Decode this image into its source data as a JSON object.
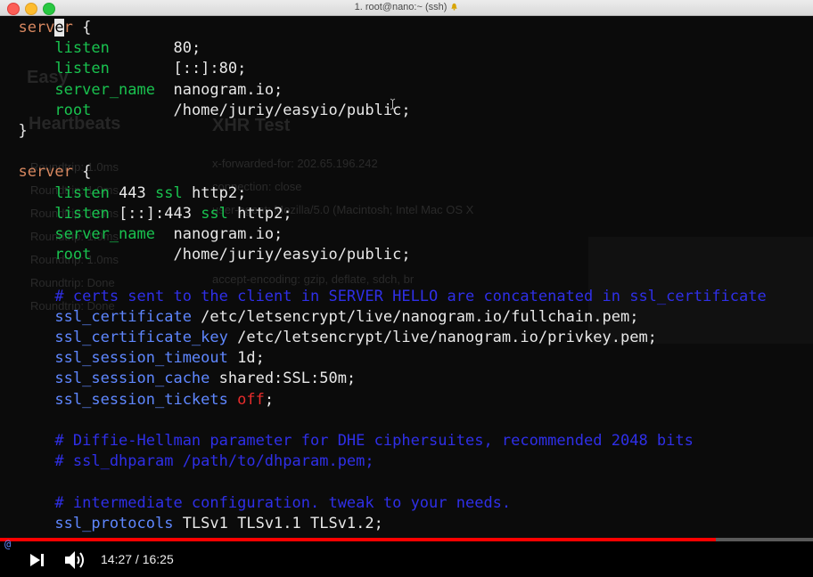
{
  "window": {
    "title": "1. root@nano:~ (ssh)"
  },
  "background_page": {
    "heading": "Easy",
    "section": "Heartbeats",
    "xhr_title": "XHR Test",
    "rows": [
      "Roundtrip: 1.0ms",
      "Roundtrip: 1.0ms",
      "Roundtrip: 1.0ms",
      "Roundtrip: 1.0ms",
      "Roundtrip: 1.0ms",
      "Roundtrip: Done",
      "Roundtrip: Done"
    ],
    "headers": [
      "x-forwarded-for: 202.65.196.242",
      "connection: close",
      "user-agent: Mozilla/5.0 (Macintosh; Intel Mac OS X",
      "accept-encoding: gzip, deflate, sdch, br"
    ]
  },
  "terminal": {
    "lines": [
      [
        {
          "t": "  serv",
          "c": "k"
        },
        {
          "t": "e",
          "c": "cursor"
        },
        {
          "t": "r",
          "c": "k"
        },
        {
          "t": " {",
          "c": "v"
        }
      ],
      [
        {
          "t": "      listen",
          "c": "d"
        },
        {
          "t": "       80;",
          "c": "v"
        }
      ],
      [
        {
          "t": "      listen",
          "c": "d"
        },
        {
          "t": "       [::]:80;",
          "c": "v"
        }
      ],
      [
        {
          "t": "      server_name",
          "c": "d"
        },
        {
          "t": "  nanogram.io;",
          "c": "v"
        }
      ],
      [
        {
          "t": "      root",
          "c": "d"
        },
        {
          "t": "         /home/juriy/easyio/public;",
          "c": "v"
        }
      ],
      [
        {
          "t": "  }",
          "c": "v"
        }
      ],
      [],
      [
        {
          "t": "  server",
          "c": "k"
        },
        {
          "t": " {",
          "c": "v"
        }
      ],
      [
        {
          "t": "      listen",
          "c": "d"
        },
        {
          "t": " 443 ",
          "c": "v"
        },
        {
          "t": "ssl",
          "c": "d"
        },
        {
          "t": " http2;",
          "c": "v"
        }
      ],
      [
        {
          "t": "      listen",
          "c": "d"
        },
        {
          "t": " [::]:443 ",
          "c": "v"
        },
        {
          "t": "ssl",
          "c": "d"
        },
        {
          "t": " http2;",
          "c": "v"
        }
      ],
      [
        {
          "t": "      server_name",
          "c": "d"
        },
        {
          "t": "  nanogram.io;",
          "c": "v"
        }
      ],
      [
        {
          "t": "      root",
          "c": "d"
        },
        {
          "t": "         /home/juriy/easyio/public;",
          "c": "v"
        }
      ],
      [],
      [
        {
          "t": "      # certs sent to the client in SERVER HELLO are concatenated in ssl_certificate",
          "c": "c"
        }
      ],
      [
        {
          "t": "      ssl_certificate",
          "c": "b"
        },
        {
          "t": " /etc/letsencrypt/live/nanogram.io/fullchain.pem;",
          "c": "v"
        }
      ],
      [
        {
          "t": "      ssl_certificate_key",
          "c": "b"
        },
        {
          "t": " /etc/letsencrypt/live/nanogram.io/privkey.pem;",
          "c": "v"
        }
      ],
      [
        {
          "t": "      ssl_session_timeout",
          "c": "b"
        },
        {
          "t": " 1d;",
          "c": "v"
        }
      ],
      [
        {
          "t": "      ssl_session_cache",
          "c": "b"
        },
        {
          "t": " shared:SSL:50m;",
          "c": "v"
        }
      ],
      [
        {
          "t": "      ssl_session_tickets",
          "c": "b"
        },
        {
          "t": " off",
          "c": "r"
        },
        {
          "t": ";",
          "c": "v"
        }
      ],
      [],
      [
        {
          "t": "      # Diffie-Hellman parameter for DHE ciphersuites, recommended 2048 bits",
          "c": "c"
        }
      ],
      [
        {
          "t": "      # ssl_dhparam /path/to/dhparam.pem;",
          "c": "c"
        }
      ],
      [],
      [
        {
          "t": "      # intermediate configuration. tweak to your needs.",
          "c": "c"
        }
      ],
      [
        {
          "t": "      ssl_protocols",
          "c": "b"
        },
        {
          "t": " TLSv1 TLSv1.1 TLSv1.2;",
          "c": "v"
        }
      ]
    ]
  },
  "vim_status": "@",
  "player": {
    "current_time": "14:27",
    "duration": "16:25",
    "time_display": "14:27 / 16:25",
    "progress": 0.88,
    "colors": {
      "progress": "#ff0000",
      "track": "#5a5a5a"
    }
  }
}
